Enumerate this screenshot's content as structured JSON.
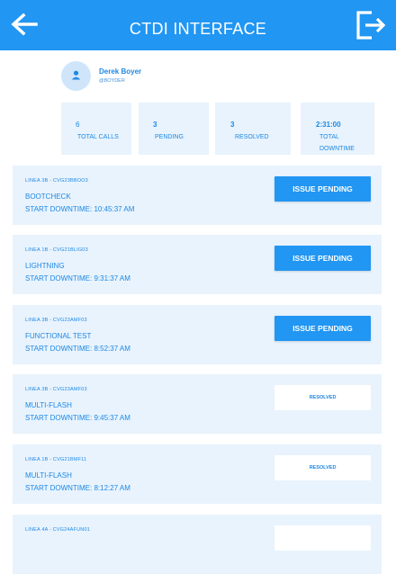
{
  "header": {
    "title": "CTDI INTERFACE"
  },
  "profile": {
    "name": "Derek Boyer",
    "handle": "@BOYDER"
  },
  "stats": [
    {
      "value": "6",
      "label": "TOTAL CALLS"
    },
    {
      "value": "3",
      "label": "PENDING"
    },
    {
      "value": "3",
      "label": "RESOLVED"
    },
    {
      "value": "2:31:00",
      "label": "TOTAL DOWNTIME"
    }
  ],
  "calls": [
    {
      "line": "LINEA 3B - CVG23BBOO3",
      "test": "BOOTCHECK",
      "start": "START DOWNTIME: 10:45:37 AM",
      "status": "ISSUE PENDING"
    },
    {
      "line": "LINEA 1B - CVG21BLIG03",
      "test": "LIGHTNING",
      "start": "START DOWNTIME: 9:31:37 AM",
      "status": "ISSUE PENDING"
    },
    {
      "line": "LINEA 3B - CVG23AMF03",
      "test": "FUNCTIONAL TEST",
      "start": "START DOWNTIME: 8:52:37 AM",
      "status": "ISSUE PENDING"
    },
    {
      "line": "LINEA 3B - CVG23AMF03",
      "test": "MULTI-FLASH",
      "start": "START DOWNTIME: 9:45:37 AM",
      "status": "RESOLVED"
    },
    {
      "line": "LINEA 1B - CVG21BMF11",
      "test": "MULTI-FLASH",
      "start": "START DOWNTIME: 8:12:27 AM",
      "status": "RESOLVED"
    },
    {
      "line": "LINEA 4A - CVG24AFUN01",
      "test": "",
      "start": "",
      "status": ""
    }
  ],
  "colors": {
    "primary": "#2196f3",
    "card_bg": "#e8f3fd",
    "text": "#1e88e5"
  },
  "icons": {
    "back": "arrow-left-icon",
    "logout": "logout-icon",
    "avatar": "user-icon"
  }
}
